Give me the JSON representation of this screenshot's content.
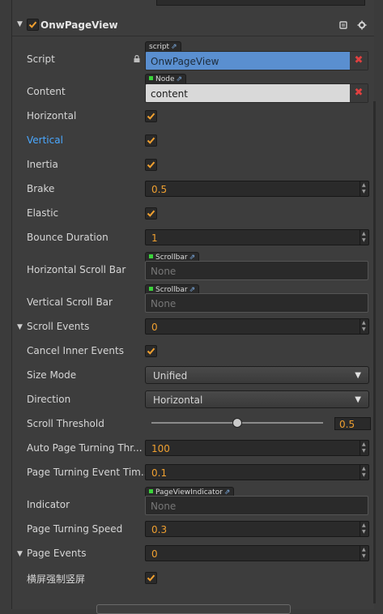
{
  "component": {
    "title": "OnwPageView",
    "enabled": true,
    "help_icon": "book-icon",
    "settings_icon": "gear-icon"
  },
  "rows": {
    "script": {
      "label": "Script",
      "tag": "script",
      "value": "OnwPageView",
      "remove": "✖"
    },
    "content": {
      "label": "Content",
      "tag": "Node",
      "value": "content",
      "remove": "✖"
    },
    "horizontal": {
      "label": "Horizontal",
      "checked": true
    },
    "vertical": {
      "label": "Vertical",
      "checked": true
    },
    "inertia": {
      "label": "Inertia",
      "checked": true
    },
    "brake": {
      "label": "Brake",
      "value": "0.5"
    },
    "elastic": {
      "label": "Elastic",
      "checked": true
    },
    "bounce_duration": {
      "label": "Bounce Duration",
      "value": "1"
    },
    "h_scroll_bar": {
      "label": "Horizontal Scroll Bar",
      "tag": "Scrollbar",
      "value": "None"
    },
    "v_scroll_bar": {
      "label": "Vertical Scroll Bar",
      "tag": "Scrollbar",
      "value": "None"
    },
    "scroll_events": {
      "label": "Scroll Events",
      "value": "0"
    },
    "cancel_inner_events": {
      "label": "Cancel Inner Events",
      "checked": true
    },
    "size_mode": {
      "label": "Size Mode",
      "value": "Unified"
    },
    "direction": {
      "label": "Direction",
      "value": "Horizontal"
    },
    "scroll_threshold": {
      "label": "Scroll Threshold",
      "value": "0.5",
      "fraction": 0.5
    },
    "auto_page_turning": {
      "label": "Auto Page Turning Thr...",
      "value": "100"
    },
    "page_turning_event": {
      "label": "Page Turning Event Tim...",
      "value": "0.1"
    },
    "indicator": {
      "label": "Indicator",
      "tag": "PageViewIndicator",
      "value": "None"
    },
    "page_turning_speed": {
      "label": "Page Turning Speed",
      "value": "0.3"
    },
    "page_events": {
      "label": "Page Events",
      "value": "0"
    },
    "force_portrait": {
      "label": "横屏强制竖屏",
      "checked": true
    }
  },
  "colors": {
    "accent": "#f0a030",
    "link": "#4aa8ff",
    "script_field": "#5a8fd0"
  }
}
